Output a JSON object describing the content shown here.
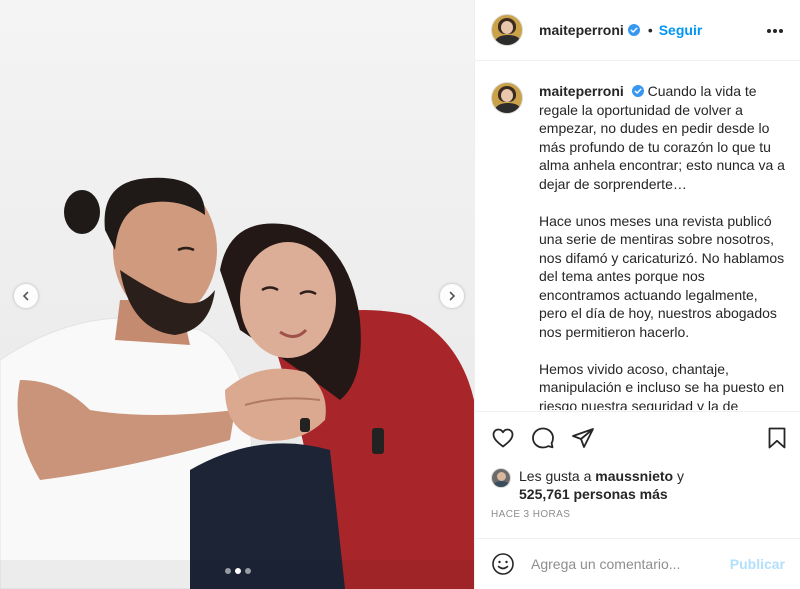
{
  "post": {
    "username": "maiteperroni",
    "follow_label": "Seguir",
    "separator": "•",
    "verified_icon": "verified-badge-icon",
    "more_icon": "more-options-icon"
  },
  "photo": {
    "description_icon": "post-photo",
    "prev_icon": "chevron-left-icon",
    "next_icon": "chevron-right-icon",
    "carousel_total": 3,
    "carousel_active": 2
  },
  "caption": {
    "username": "maiteperroni",
    "paragraphs": [
      "Cuando la vida te regale la oportunidad de volver a empezar, no dudes en pedir desde lo más profundo de tu corazón lo que tu alma anhela encontrar; esto nunca va a dejar de sorprenderte…",
      "Hace unos meses una revista publicó una serie de mentiras sobre nosotros, nos difamó y caricaturizó. No hablamos del tema antes porque nos encontramos actuando legalmente, pero el día de hoy, nuestros abogados nos permitieron hacerlo.",
      "Hemos vivido acoso, chantaje, manipulación e incluso se ha puesto en riesgo nuestra seguridad y la de nuestras familias."
    ]
  },
  "actions": {
    "like_icon": "heart-icon",
    "comment_icon": "comment-icon",
    "share_icon": "share-icon",
    "save_icon": "bookmark-icon"
  },
  "likes": {
    "prefix": "Les gusta a ",
    "liker": "maussnieto",
    "middle": " y",
    "count": "525,761 personas más"
  },
  "timestamp": "Hace 3 horas",
  "comment": {
    "placeholder": "Agrega un comentario...",
    "publish_label": "Publicar",
    "emoji_icon": "emoji-icon"
  },
  "colors": {
    "accent": "#0095f6",
    "publish_disabled": "#b2dffc",
    "text": "#262626",
    "muted": "#8e8e8e",
    "border": "#efefef"
  }
}
